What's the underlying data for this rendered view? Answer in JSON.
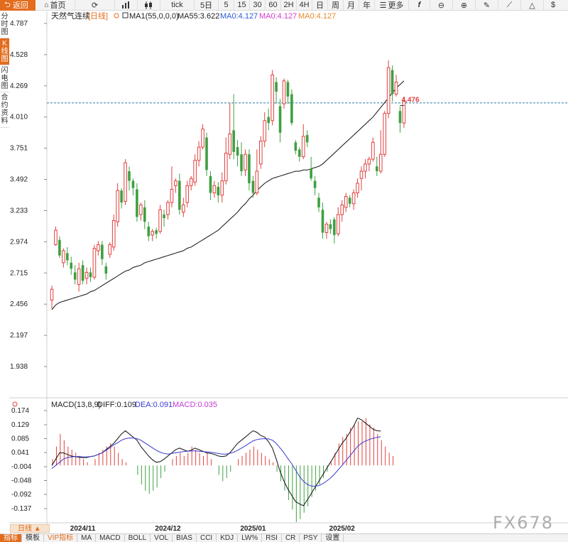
{
  "toolbar": {
    "back": "返回",
    "home": "首页",
    "items": [
      "tick",
      "5日",
      "5",
      "15",
      "30",
      "60",
      "2H",
      "4H",
      "日",
      "周",
      "月",
      "年"
    ],
    "more": "更多"
  },
  "left_tabs": [
    {
      "label": "分时图",
      "active": false
    },
    {
      "label": "K线图",
      "active": true
    },
    {
      "label": "闪电图",
      "active": false
    },
    {
      "label": "合约资料",
      "active": false
    }
  ],
  "legend": {
    "name": "天然气连续",
    "period": "[日线]",
    "ma1": "MA1(55,0,0,0)",
    "ma55": "MA55:3.622",
    "ma0a": "MA0:4.127",
    "ma0b": "MA0:4.127",
    "ma0c": "MA0:4.127"
  },
  "macd_legend": {
    "name": "MACD(13,8,9)",
    "diff": "DIFF:0.109",
    "dea": "DEA:0.091",
    "macd": "MACD:0.035"
  },
  "colors": {
    "up": "#e0413e",
    "down": "#3ea041",
    "accent": "#e36c1d",
    "dea": "#3a3acf",
    "macd_text": "#c43ad1",
    "price_line": "#2a7cae"
  },
  "period_selector": "日线 ▲",
  "bottom_tabs": [
    "指标",
    "模板",
    "VIP指标",
    "MA",
    "MACD",
    "BOLL",
    "VOL",
    "BIAS",
    "CCI",
    "KDJ",
    "LW%",
    "RSI",
    "CR",
    "PSY",
    "设置"
  ],
  "watermark": "FX678",
  "chart_data": {
    "type": "candlestick",
    "price_axis": {
      "ticks": [
        "4.787",
        "4.528",
        "4.269",
        "4.010",
        "3.751",
        "3.492",
        "3.233",
        "2.974",
        "2.715",
        "2.456",
        "2.197",
        "1.938"
      ],
      "range": [
        1.938,
        4.787
      ]
    },
    "macd_axis": {
      "ticks": [
        "0.174",
        "0.129",
        "0.085",
        "0.041",
        "-0.004",
        "-0.048",
        "-0.092",
        "-0.137"
      ],
      "range": [
        -0.137,
        0.174
      ]
    },
    "x_labels": [
      "2024/11",
      "2024/12",
      "2025/01",
      "2025/02"
    ],
    "x_label_index": [
      8,
      30,
      52,
      75
    ],
    "max_marker": {
      "label": "4.476",
      "index": 90
    },
    "current_price": 4.127,
    "candles": [
      [
        2.49,
        2.58,
        2.42,
        2.61
      ],
      [
        2.95,
        3.07,
        2.94,
        3.1
      ],
      [
        2.99,
        2.86,
        2.84,
        3.02
      ],
      [
        2.8,
        2.9,
        2.76,
        2.92
      ],
      [
        2.88,
        2.82,
        2.78,
        2.93
      ],
      [
        2.8,
        2.75,
        2.7,
        2.85
      ],
      [
        2.72,
        2.66,
        2.62,
        2.78
      ],
      [
        2.62,
        2.75,
        2.56,
        2.8
      ],
      [
        2.78,
        2.65,
        2.62,
        2.82
      ],
      [
        2.67,
        2.72,
        2.62,
        2.76
      ],
      [
        2.72,
        2.68,
        2.64,
        2.76
      ],
      [
        2.68,
        2.92,
        2.66,
        2.95
      ],
      [
        2.9,
        2.95,
        2.86,
        2.98
      ],
      [
        2.95,
        2.83,
        2.78,
        2.98
      ],
      [
        2.77,
        2.71,
        2.66,
        2.8
      ],
      [
        2.87,
        2.95,
        2.84,
        2.97
      ],
      [
        2.93,
        3.15,
        2.9,
        3.2
      ],
      [
        3.14,
        3.4,
        3.1,
        3.46
      ],
      [
        3.4,
        3.3,
        3.25,
        3.42
      ],
      [
        3.31,
        3.63,
        3.28,
        3.66
      ],
      [
        3.56,
        3.48,
        3.4,
        3.6
      ],
      [
        3.48,
        3.42,
        3.36,
        3.5
      ],
      [
        3.41,
        3.18,
        3.14,
        3.46
      ],
      [
        3.2,
        3.28,
        3.15,
        3.3
      ],
      [
        3.26,
        3.14,
        3.08,
        3.32
      ],
      [
        3.1,
        3.02,
        2.98,
        3.14
      ],
      [
        3.03,
        3.06,
        2.98,
        3.08
      ],
      [
        3.07,
        3.04,
        3.0,
        3.09
      ],
      [
        3.06,
        3.24,
        3.04,
        3.28
      ],
      [
        3.2,
        3.17,
        3.1,
        3.24
      ],
      [
        3.2,
        3.3,
        3.16,
        3.32
      ],
      [
        3.3,
        3.41,
        3.26,
        3.6
      ],
      [
        3.44,
        3.48,
        3.38,
        3.5
      ],
      [
        3.48,
        3.24,
        3.2,
        3.54
      ],
      [
        3.22,
        3.28,
        3.18,
        3.34
      ],
      [
        3.3,
        3.44,
        3.26,
        3.48
      ],
      [
        3.44,
        3.5,
        3.4,
        3.52
      ],
      [
        3.47,
        3.65,
        3.44,
        3.7
      ],
      [
        3.65,
        3.76,
        3.6,
        3.81
      ],
      [
        3.76,
        3.91,
        3.74,
        3.95
      ],
      [
        3.84,
        3.57,
        3.52,
        3.88
      ],
      [
        3.52,
        3.38,
        3.32,
        3.56
      ],
      [
        3.38,
        3.44,
        3.34,
        3.48
      ],
      [
        3.43,
        3.36,
        3.3,
        3.47
      ],
      [
        3.36,
        3.48,
        3.3,
        3.55
      ],
      [
        3.48,
        3.71,
        3.45,
        3.84
      ],
      [
        3.7,
        3.87,
        3.66,
        4.13
      ],
      [
        3.9,
        3.72,
        3.66,
        4.2
      ],
      [
        3.76,
        3.69,
        3.6,
        3.82
      ],
      [
        3.7,
        3.56,
        3.52,
        3.8
      ],
      [
        3.57,
        3.7,
        3.52,
        3.74
      ],
      [
        3.7,
        3.46,
        3.4,
        3.74
      ],
      [
        3.48,
        3.38,
        3.34,
        3.52
      ],
      [
        3.38,
        3.56,
        3.36,
        3.74
      ],
      [
        3.62,
        3.81,
        3.58,
        3.85
      ],
      [
        3.81,
        3.98,
        3.76,
        4.05
      ],
      [
        4.01,
        3.96,
        3.9,
        4.08
      ],
      [
        3.98,
        4.36,
        3.94,
        4.4
      ],
      [
        4.3,
        4.22,
        4.12,
        4.34
      ],
      [
        4.1,
        3.88,
        3.8,
        4.16
      ],
      [
        4.12,
        4.31,
        4.08,
        4.33
      ],
      [
        4.3,
        4.18,
        4.12,
        4.32
      ],
      [
        4.2,
        3.96,
        3.94,
        4.24
      ],
      [
        3.8,
        3.73,
        3.7,
        3.82
      ],
      [
        3.74,
        3.68,
        3.64,
        3.76
      ],
      [
        3.68,
        3.85,
        3.66,
        3.95
      ],
      [
        3.86,
        3.8,
        3.76,
        3.9
      ],
      [
        3.58,
        3.5,
        3.48,
        3.68
      ],
      [
        3.48,
        3.42,
        3.36,
        3.52
      ],
      [
        3.34,
        3.26,
        3.22,
        3.38
      ],
      [
        3.24,
        3.05,
        3.0,
        3.3
      ],
      [
        3.05,
        3.12,
        3.0,
        3.14
      ],
      [
        3.12,
        3.08,
        3.04,
        3.16
      ],
      [
        3.16,
        3.03,
        2.96,
        3.18
      ],
      [
        3.04,
        3.2,
        3.02,
        3.26
      ],
      [
        3.2,
        3.28,
        3.14,
        3.32
      ],
      [
        3.26,
        3.35,
        3.22,
        3.38
      ],
      [
        3.34,
        3.29,
        3.26,
        3.36
      ],
      [
        3.29,
        3.38,
        3.24,
        3.41
      ],
      [
        3.38,
        3.46,
        3.34,
        3.5
      ],
      [
        3.5,
        3.56,
        3.4,
        3.6
      ],
      [
        3.56,
        3.62,
        3.5,
        3.66
      ],
      [
        3.62,
        3.66,
        3.56,
        3.68
      ],
      [
        3.66,
        3.8,
        3.64,
        3.84
      ],
      [
        3.6,
        3.56,
        3.52,
        3.68
      ],
      [
        3.56,
        3.7,
        3.54,
        3.9
      ],
      [
        3.7,
        4.04,
        3.68,
        4.06
      ],
      [
        4.04,
        4.42,
        4.0,
        4.48
      ],
      [
        4.4,
        4.2,
        4.14,
        4.44
      ],
      [
        4.2,
        4.3,
        4.18,
        4.36
      ],
      [
        4.06,
        3.96,
        3.88,
        4.1
      ],
      [
        3.96,
        4.14,
        3.92,
        4.18
      ]
    ],
    "ma55": {
      "start_index": 0,
      "values": [
        2.41,
        2.45,
        2.47,
        2.48,
        2.49,
        2.5,
        2.51,
        2.52,
        2.53,
        2.54,
        2.56,
        2.57,
        2.59,
        2.61,
        2.63,
        2.65,
        2.67,
        2.69,
        2.71,
        2.73,
        2.74,
        2.76,
        2.77,
        2.78,
        2.8,
        2.81,
        2.82,
        2.83,
        2.84,
        2.85,
        2.86,
        2.87,
        2.88,
        2.89,
        2.9,
        2.92,
        2.93,
        2.95,
        2.97,
        2.99,
        3.01,
        3.03,
        3.05,
        3.07,
        3.1,
        3.13,
        3.16,
        3.19,
        3.22,
        3.26,
        3.29,
        3.33,
        3.36,
        3.4,
        3.43,
        3.46,
        3.48,
        3.5,
        3.51,
        3.52,
        3.53,
        3.54,
        3.55,
        3.56,
        3.56,
        3.57,
        3.57,
        3.58,
        3.59,
        3.6,
        3.62,
        3.65,
        3.68,
        3.71,
        3.74,
        3.77,
        3.8,
        3.83,
        3.86,
        3.89,
        3.92,
        3.95,
        3.98,
        4.01,
        4.05,
        4.09,
        4.13,
        4.17,
        4.21,
        4.25,
        4.28,
        4.31
      ]
    },
    "macd": {
      "hist": [
        0.02,
        0.06,
        0.1,
        0.08,
        0.06,
        0.05,
        0.04,
        0.03,
        0.02,
        0.01,
        0.0,
        0.02,
        0.04,
        0.05,
        0.06,
        0.07,
        0.06,
        0.04,
        0.02,
        0.01,
        0.0,
        0.0,
        -0.03,
        -0.06,
        -0.08,
        -0.09,
        -0.08,
        -0.07,
        -0.04,
        -0.02,
        0.0,
        0.02,
        0.03,
        0.04,
        0.03,
        0.04,
        0.06,
        0.05,
        0.04,
        0.03,
        0.04,
        0.02,
        0.0,
        -0.03,
        -0.05,
        -0.04,
        -0.02,
        0.0,
        0.02,
        0.03,
        0.04,
        0.05,
        0.06,
        0.05,
        0.04,
        0.03,
        0.02,
        0.01,
        -0.02,
        -0.05,
        -0.08,
        -0.11,
        -0.14,
        -0.18,
        -0.17,
        -0.15,
        -0.13,
        -0.1,
        -0.08,
        -0.06,
        -0.04,
        -0.02,
        0.01,
        0.04,
        0.07,
        0.09,
        0.1,
        0.12,
        0.13,
        0.14,
        0.14,
        0.15,
        0.13,
        0.12,
        0.1,
        0.08,
        0.06,
        0.04,
        0.03
      ],
      "diff": [
        0.0,
        0.02,
        0.04,
        0.04,
        0.035,
        0.03,
        0.028,
        0.026,
        0.025,
        0.025,
        0.028,
        0.03,
        0.035,
        0.04,
        0.05,
        0.06,
        0.07,
        0.085,
        0.1,
        0.11,
        0.1,
        0.09,
        0.08,
        0.06,
        0.045,
        0.03,
        0.018,
        0.01,
        0.012,
        0.02,
        0.03,
        0.04,
        0.05,
        0.055,
        0.05,
        0.045,
        0.048,
        0.055,
        0.05,
        0.045,
        0.04,
        0.038,
        0.035,
        0.03,
        0.028,
        0.03,
        0.04,
        0.055,
        0.07,
        0.08,
        0.09,
        0.1,
        0.11,
        0.105,
        0.095,
        0.09,
        0.075,
        0.055,
        0.02,
        -0.02,
        -0.05,
        -0.075,
        -0.095,
        -0.115,
        -0.122,
        -0.128,
        -0.11,
        -0.09,
        -0.07,
        -0.05,
        -0.03,
        -0.01,
        0.01,
        0.03,
        0.05,
        0.07,
        0.085,
        0.105,
        0.125,
        0.15,
        0.145,
        0.135,
        0.125,
        0.115,
        0.11,
        0.109
      ],
      "dea": [
        -0.01,
        0.0,
        0.01,
        0.02,
        0.025,
        0.027,
        0.028,
        0.028,
        0.027,
        0.027,
        0.028,
        0.03,
        0.035,
        0.04,
        0.048,
        0.056,
        0.065,
        0.072,
        0.08,
        0.085,
        0.087,
        0.087,
        0.085,
        0.08,
        0.072,
        0.064,
        0.056,
        0.048,
        0.042,
        0.038,
        0.036,
        0.038,
        0.04,
        0.042,
        0.044,
        0.045,
        0.046,
        0.046,
        0.045,
        0.044,
        0.043,
        0.042,
        0.04,
        0.038,
        0.036,
        0.036,
        0.038,
        0.042,
        0.048,
        0.055,
        0.062,
        0.07,
        0.078,
        0.082,
        0.084,
        0.085,
        0.084,
        0.08,
        0.07,
        0.055,
        0.04,
        0.022,
        0.005,
        -0.015,
        -0.035,
        -0.05,
        -0.06,
        -0.065,
        -0.066,
        -0.064,
        -0.058,
        -0.05,
        -0.04,
        -0.028,
        -0.014,
        0.0,
        0.015,
        0.03,
        0.045,
        0.06,
        0.07,
        0.077,
        0.082,
        0.086,
        0.089,
        0.091
      ]
    }
  }
}
